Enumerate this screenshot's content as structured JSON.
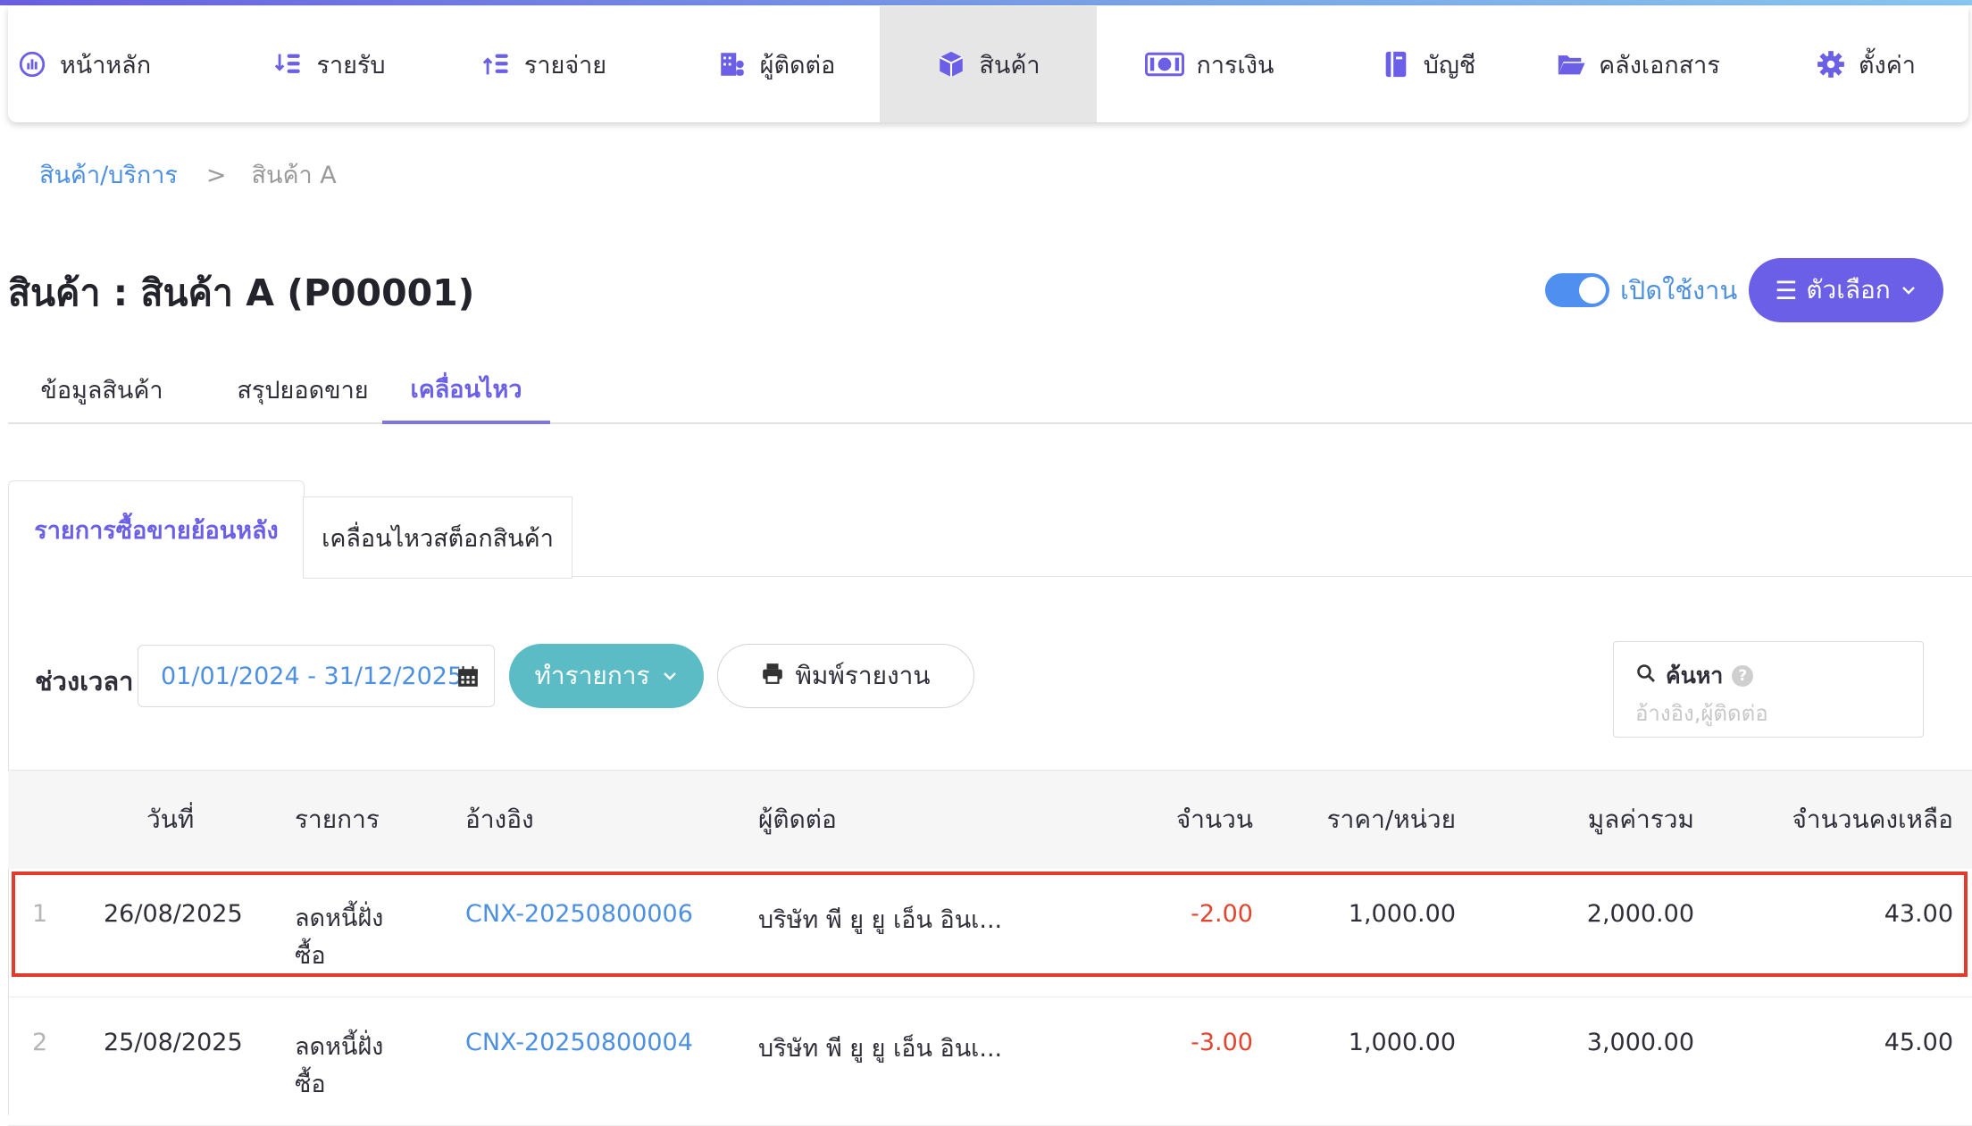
{
  "nav": {
    "items": [
      {
        "label": "หน้าหลัก",
        "icon": "dashboard-chart-icon"
      },
      {
        "label": "รายรับ",
        "icon": "income-list-icon"
      },
      {
        "label": "รายจ่าย",
        "icon": "expense-list-icon"
      },
      {
        "label": "ผู้ติดต่อ",
        "icon": "building-contacts-icon"
      },
      {
        "label": "สินค้า",
        "icon": "box-icon",
        "active": true
      },
      {
        "label": "การเงิน",
        "icon": "money-icon"
      },
      {
        "label": "บัญชี",
        "icon": "ledger-book-icon"
      },
      {
        "label": "คลังเอกสาร",
        "icon": "folder-icon"
      },
      {
        "label": "ตั้งค่า",
        "icon": "gear-icon"
      }
    ]
  },
  "breadcrumb": {
    "parent": "สินค้า/บริการ",
    "separator": ">",
    "current": "สินค้า A"
  },
  "page": {
    "title": "สินค้า : สินค้า A (P00001)",
    "toggle_label": "เปิดใช้งาน",
    "toggle_on": true,
    "options_label": "ตัวเลือก"
  },
  "tabs": {
    "info": "ข้อมูลสินค้า",
    "sales_summary": "สรุปยอดขาย",
    "movement": "เคลื่อนไหว"
  },
  "subtabs": {
    "history": "รายการซื้อขายย้อนหลัง",
    "stock": "เคลื่อนไหวสต็อกสินค้า"
  },
  "filters": {
    "period_label": "ช่วงเวลา",
    "date_range": "01/01/2024 - 31/12/2025",
    "action_label": "ทำรายการ",
    "print_label": "พิมพ์รายงาน",
    "search_label": "ค้นหา",
    "search_help": "?",
    "search_placeholder": "อ้างอิง,ผู้ติดต่อ"
  },
  "table": {
    "headers": {
      "date": "วันที่",
      "item": "รายการ",
      "reference": "อ้างอิง",
      "contact": "ผู้ติดต่อ",
      "quantity": "จำนวน",
      "unit_price": "ราคา/หน่วย",
      "total": "มูลค่ารวม",
      "remaining": "จำนวนคงเหลือ"
    },
    "rows": [
      {
        "no": "1",
        "date": "26/08/2025",
        "item_line1": "ลดหนี้ฝั่ง",
        "item_line2": "ซื้อ",
        "reference": "CNX-20250800006",
        "contact": "บริษัท พี ยู ยู เอ็น อินเ...",
        "quantity": "-2.00",
        "unit_price": "1,000.00",
        "total": "2,000.00",
        "remaining": "43.00"
      },
      {
        "no": "2",
        "date": "25/08/2025",
        "item_line1": "ลดหนี้ฝั่ง",
        "item_line2": "ซื้อ",
        "reference": "CNX-20250800004",
        "contact": "บริษัท พี ยู ยู เอ็น อินเ...",
        "quantity": "-3.00",
        "unit_price": "1,000.00",
        "total": "3,000.00",
        "remaining": "45.00"
      }
    ]
  },
  "colors": {
    "accent": "#6a5fe6",
    "link": "#4d8fe0",
    "teal_button": "#5bbcc6",
    "negative": "#e2452e",
    "highlight_border": "#e03b2b"
  }
}
